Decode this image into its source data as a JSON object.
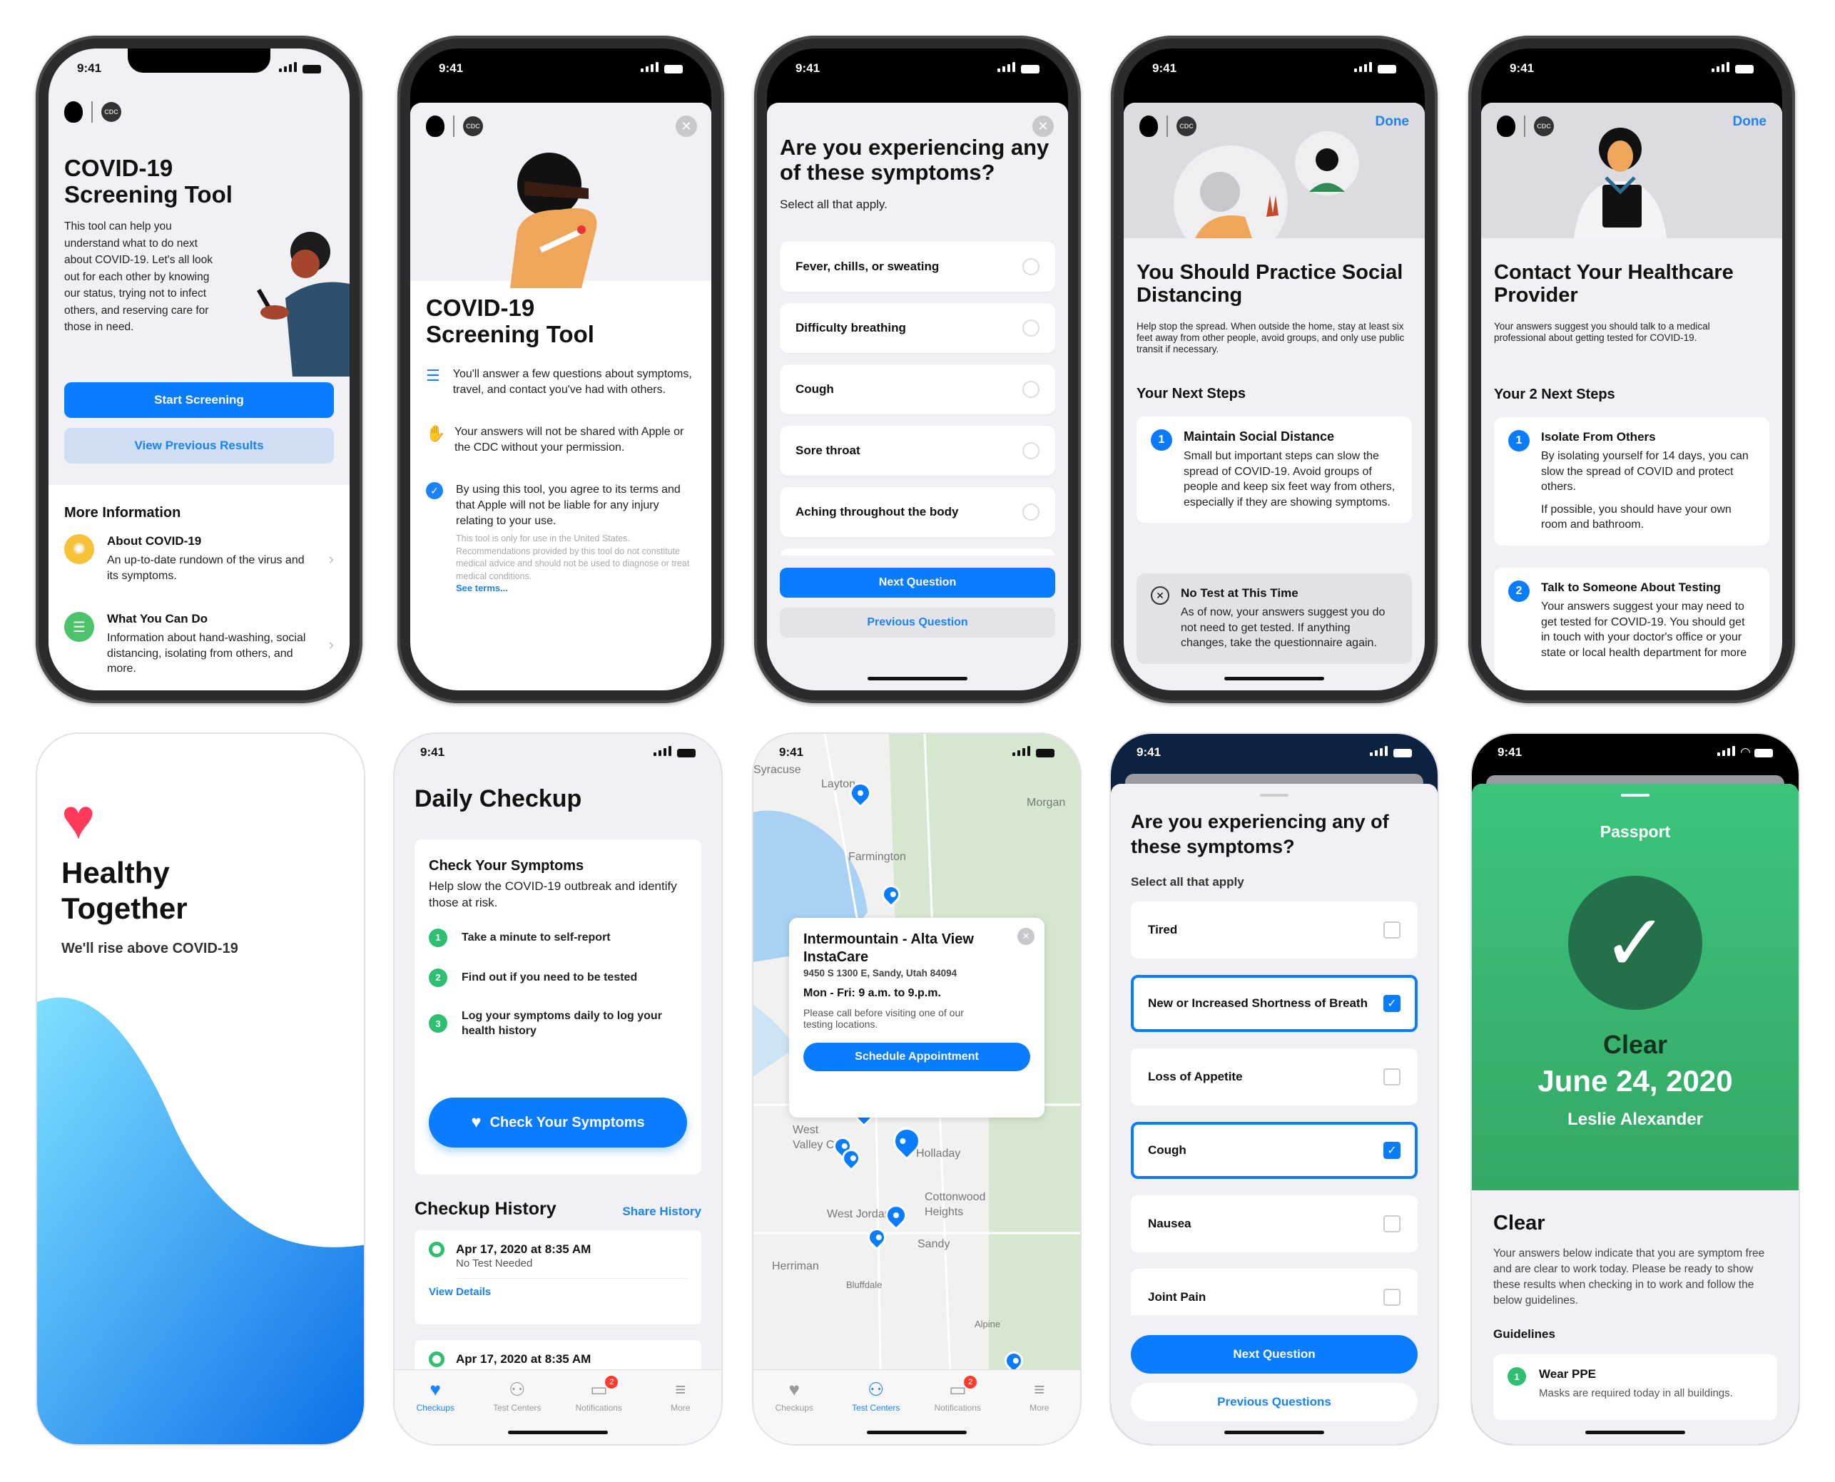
{
  "status_time": "9:41",
  "colors": {
    "accent": "#0a7cff",
    "green": "#3cc47c",
    "dark_green": "#23704b",
    "heart": "#ff3b5c"
  },
  "phone1": {
    "cdc": "CDC",
    "title": "COVID-19 Screening Tool",
    "intro": "This tool can help you understand what to do next about COVID-19. Let's all look out for each other by knowing our status, trying not to infect others, and reserving care for those in need.",
    "start_button": "Start Screening",
    "previous_button": "View Previous Results",
    "more_heading": "More Information",
    "items": [
      {
        "title": "About COVID-19",
        "desc": "An up-to-date rundown of the virus and its symptoms."
      },
      {
        "title": "What You Can Do",
        "desc": "Information about hand-washing, social distancing, isolating from others, and more."
      }
    ]
  },
  "phone2": {
    "cdc": "CDC",
    "title": "COVID-19 Screening Tool",
    "bullets": [
      "You'll answer a few questions about symptoms, travel, and contact you've had with others.",
      "Your answers will not be shared with Apple or the CDC without your permission.",
      "By using this tool, you agree to its terms and that Apple will not be liable for any injury relating to your use."
    ],
    "disclaimer": "This tool is only for use in the United States. Recommendations provided by this tool do not constitute medical advice and should not be used to diagnose or treat medical conditions.",
    "see_terms": "See terms..."
  },
  "phone3": {
    "title": "Are you experiencing any of these symptoms?",
    "subtitle": "Select all that apply.",
    "options": [
      "Fever, chills, or sweating",
      "Difficulty breathing",
      "Cough",
      "Sore throat",
      "Aching throughout the body"
    ],
    "next": "Next Question",
    "previous": "Previous Question"
  },
  "phone4": {
    "cdc": "CDC",
    "done": "Done",
    "title": "You Should Practice Social Distancing",
    "desc": "Help stop the spread. When outside the home, stay at least six feet away from other people, avoid groups, and only use public transit if necessary.",
    "steps_heading": "Your Next Steps",
    "step": {
      "num": "1",
      "title": "Maintain Social Distance",
      "body": "Small but important steps can slow the spread of COVID-19. Avoid groups of people and keep six feet way from others, especially if they are showing symptoms."
    },
    "no_test": {
      "title": "No Test at This Time",
      "body": "As of now, your answers suggest you do not need to get tested. If anything changes, take the questionnaire again."
    }
  },
  "phone5": {
    "cdc": "CDC",
    "done": "Done",
    "title": "Contact Your Healthcare Provider",
    "desc": "Your answers suggest you should talk to a medical professional about getting tested for COVID-19.",
    "steps_heading": "Your 2 Next Steps",
    "steps": [
      {
        "num": "1",
        "title": "Isolate From Others",
        "body": "By isolating yourself for 14 days, you can slow the spread of COVID and protect others.",
        "body2": "If possible, you should have your own room and bathroom."
      },
      {
        "num": "2",
        "title": "Talk to Someone About Testing",
        "body": "Your answers suggest your may need to get tested for COVID-19. You should get in touch with your doctor's office or your state or local health department for more"
      }
    ]
  },
  "phone6": {
    "title": "Healthy Together",
    "tagline": "We'll rise above COVID-19"
  },
  "phone7": {
    "title": "Daily Checkup",
    "card_title": "Check Your Symptoms",
    "card_desc": "Help slow the COVID-19 outbreak and identify those at risk.",
    "steps": [
      {
        "num": "1",
        "text": "Take a minute to self-report"
      },
      {
        "num": "2",
        "text": "Find out if you need to be tested"
      },
      {
        "num": "3",
        "text": "Log your symptoms daily to log your health history"
      }
    ],
    "cta": "Check Your Symptoms",
    "history_title": "Checkup History",
    "share": "Share History",
    "entries": [
      {
        "date": "Apr 17, 2020 at 8:35 AM",
        "status": "No Test Needed",
        "link": "View Details"
      },
      {
        "date": "Apr 17, 2020 at 8:35 AM"
      }
    ]
  },
  "tabs": [
    {
      "label": "Checkups",
      "icon": "heart-icon"
    },
    {
      "label": "Test Centers",
      "icon": "people-icon"
    },
    {
      "label": "Notifications",
      "icon": "notification-icon",
      "badge": "2"
    },
    {
      "label": "More",
      "icon": "menu-icon"
    }
  ],
  "phone8": {
    "map_labels": [
      "Syracuse",
      "Layton",
      "Morgan",
      "Farmington",
      "West Valley City",
      "Holladay",
      "Cottonwood Heights",
      "West Jordan",
      "Sandy",
      "Herriman",
      "Bluffdale",
      "Alpine"
    ],
    "popup": {
      "name": "Intermountain - Alta View InstaCare",
      "address": "9450 S 1300 E, Sandy, Utah 84094",
      "hours": "Mon - Fri: 9 a.m. to 9.p.m.",
      "note": "Please call before visiting one of our testing locations.",
      "button": "Schedule Appointment"
    }
  },
  "phone9": {
    "title": "Are you experiencing any of these symptoms?",
    "subtitle": "Select all that apply",
    "options": [
      {
        "label": "Tired",
        "checked": false
      },
      {
        "label": "New or Increased Shortness of Breath",
        "checked": true
      },
      {
        "label": "Loss of Appetite",
        "checked": false
      },
      {
        "label": "Cough",
        "checked": true
      },
      {
        "label": "Nausea",
        "checked": false
      },
      {
        "label": "Joint Pain",
        "checked": false
      }
    ],
    "next": "Next Question",
    "previous": "Previous Questions"
  },
  "phone10": {
    "header": "Passport",
    "status": "Clear",
    "date": "June 24, 2020",
    "name": "Leslie Alexander",
    "section_title": "Clear",
    "body": "Your answers below indicate that you are symptom free and are clear to work today. Please be ready to show these results when checking in to work and follow the below guidelines.",
    "guidelines_heading": "Guidelines",
    "guideline": {
      "num": "1",
      "title": "Wear PPE",
      "desc": "Masks are required today in all buildings."
    }
  }
}
